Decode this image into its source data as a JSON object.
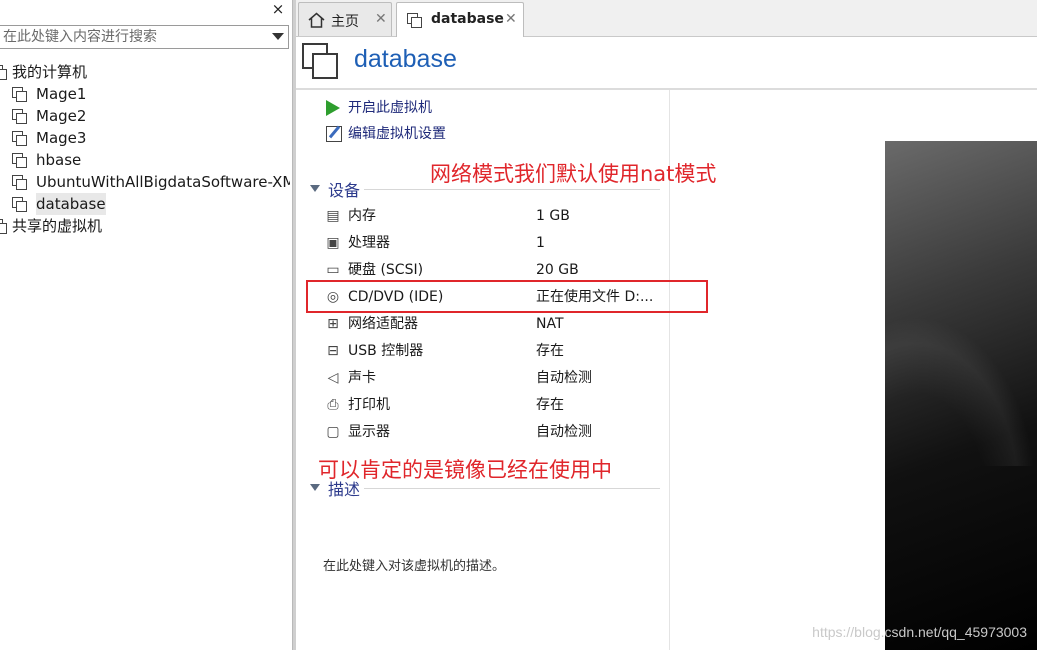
{
  "library": {
    "search_placeholder": "在此处键入内容进行搜索",
    "close_symbol": "×",
    "root_label": "我的计算机",
    "vms": [
      {
        "label": "Mage1"
      },
      {
        "label": "Mage2"
      },
      {
        "label": "Mage3"
      },
      {
        "label": "hbase"
      },
      {
        "label": "UbuntuWithAllBigdataSoftware-XM"
      },
      {
        "label": "database",
        "selected": true
      }
    ],
    "shared_label": "共享的虚拟机"
  },
  "tabs": [
    {
      "label": "主页",
      "icon": "home-icon",
      "active": false
    },
    {
      "label": "database",
      "icon": "vm-icon",
      "active": true
    }
  ],
  "tab_close_symbol": "✕",
  "vm": {
    "title": "database",
    "actions": [
      {
        "label": "开启此虚拟机",
        "icon": "play-icon"
      },
      {
        "label": "编辑虚拟机设置",
        "icon": "edit-settings-icon"
      }
    ],
    "devices_heading": "设备",
    "devices": [
      {
        "name": "内存",
        "value": "1 GB",
        "icon": "memory-icon"
      },
      {
        "name": "处理器",
        "value": "1",
        "icon": "cpu-icon"
      },
      {
        "name": "硬盘 (SCSI)",
        "value": "20 GB",
        "icon": "hard-disk-icon"
      },
      {
        "name": "CD/DVD (IDE)",
        "value": "正在使用文件 D:...",
        "icon": "cd-dvd-icon"
      },
      {
        "name": "网络适配器",
        "value": "NAT",
        "icon": "network-adapter-icon"
      },
      {
        "name": "USB 控制器",
        "value": "存在",
        "icon": "usb-icon"
      },
      {
        "name": "声卡",
        "value": "自动检测",
        "icon": "speaker-icon"
      },
      {
        "name": "打印机",
        "value": "存在",
        "icon": "printer-icon"
      },
      {
        "name": "显示器",
        "value": "自动检测",
        "icon": "monitor-icon"
      }
    ],
    "description_heading": "描述",
    "description_placeholder": "在此处键入对该虚拟机的描述。"
  },
  "annotations": {
    "network_note": "网络模式我们默认使用nat模式",
    "image_note": "可以肯定的是镜像已经在使用中",
    "accent_color": "#e0262b"
  },
  "watermark": "https://blog.csdn.net/qq_45973003"
}
